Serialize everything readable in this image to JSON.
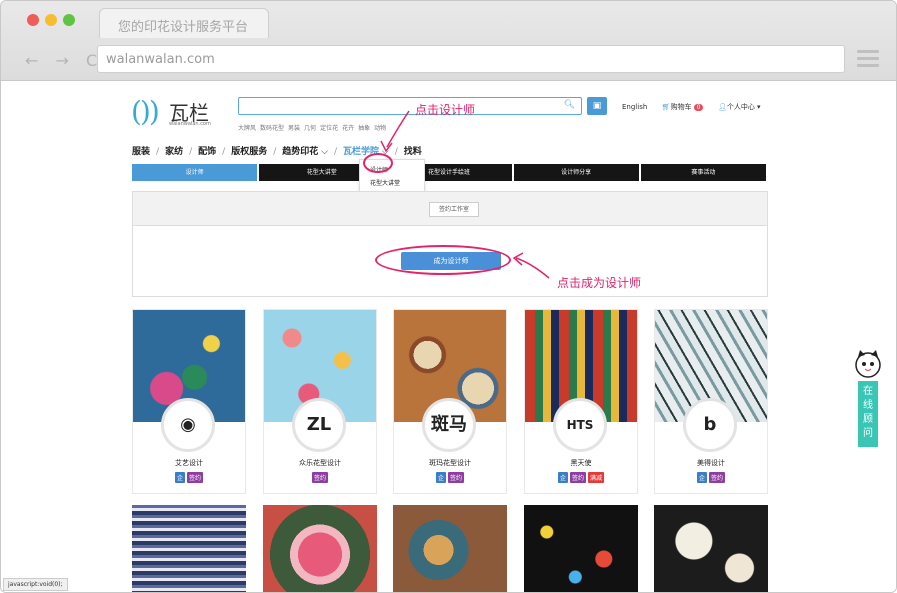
{
  "browser": {
    "tab_title": "您的印花设计服务平台",
    "url": "walanwalan.com",
    "nav_glyphs": "← → C"
  },
  "header": {
    "logo_mark": "())",
    "logo_text": "瓦栏",
    "logo_sub": "walanwalan.com",
    "search_placeholder": "",
    "hot_tags": [
      "大牌风",
      "数码花型",
      "男装",
      "几何",
      "定位花",
      "花卉",
      "抽象",
      "动物"
    ],
    "lang": "English",
    "cart_label": "购物车",
    "cart_count": "0",
    "user_label": "个人中心"
  },
  "mainnav": {
    "items": [
      "服装",
      "家纺",
      "配饰",
      "版权服务",
      "趋势印花",
      "瓦栏学院",
      "找料"
    ],
    "separator": "/"
  },
  "dropdown": {
    "items": [
      "设计师",
      "花型大讲堂",
      "花型设计手绘班",
      "设计师分享",
      "赛事活动"
    ]
  },
  "subtabs": [
    "设计师",
    "花型大讲堂",
    "花型设计手绘班",
    "设计师分享",
    "赛事活动"
  ],
  "panel": {
    "filter_label": "签约工作室",
    "become_label": "成为设计师"
  },
  "annotations": {
    "click_designer": "点击设计师",
    "click_become": "点击成为设计师"
  },
  "designers": [
    {
      "name": "艾艺设计",
      "avatar": "◉",
      "badges": [
        "企",
        "签约"
      ]
    },
    {
      "name": "众乐花型设计",
      "avatar": "ZL",
      "badges": [
        "签约"
      ]
    },
    {
      "name": "斑玛花型设计",
      "avatar": "斑马",
      "badges": [
        "企",
        "签约"
      ]
    },
    {
      "name": "黑天使",
      "avatar": "HTS",
      "badges": [
        "企",
        "签约",
        "满减"
      ]
    },
    {
      "name": "美得设计",
      "avatar": "b",
      "badges": [
        "企",
        "签约"
      ]
    }
  ],
  "chat": {
    "label": "在线顾问"
  },
  "status_bar": "javascript:void(0);",
  "colors": {
    "brand_blue": "#4a9ad8",
    "annotation_pink": "#e2246b",
    "chat_teal": "#39c6b5",
    "badge_qi": "#3a7ec7",
    "badge_qy": "#8e3ea0",
    "badge_mj": "#e43a3a"
  }
}
